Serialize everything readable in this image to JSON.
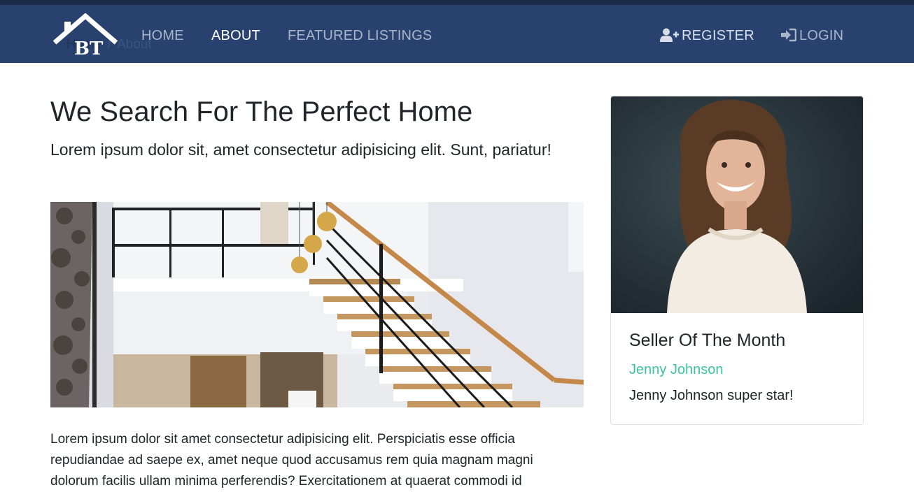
{
  "brand": {
    "logo_letters": "BT"
  },
  "breadcrumb": {
    "home": "Home",
    "current": "About"
  },
  "nav": {
    "home": "HOME",
    "about": "ABOUT",
    "featured": "FEATURED LISTINGS",
    "register": "REGISTER",
    "login": "LOGIN",
    "register_icon": "user-plus-icon",
    "login_icon": "sign-in-icon"
  },
  "main": {
    "title": "We Search For The Perfect Home",
    "lead": "Lorem ipsum dolor sit, amet consectetur adipisicing elit. Sunt, pariatur!",
    "body": "Lorem ipsum dolor sit amet consectetur adipisicing elit. Perspiciatis esse officia repudiandae ad saepe ex, amet neque quod accusamus rem quia magnam magni dolorum facilis ullam minima perferendis? Exercitationem at quaerat commodi id"
  },
  "seller": {
    "heading": "Seller Of The Month",
    "name": "Jenny Johnson",
    "tagline": "Jenny Johnson super star!"
  },
  "colors": {
    "navbar": "#28416e",
    "accent": "#3cc49d",
    "text": "#212529"
  }
}
